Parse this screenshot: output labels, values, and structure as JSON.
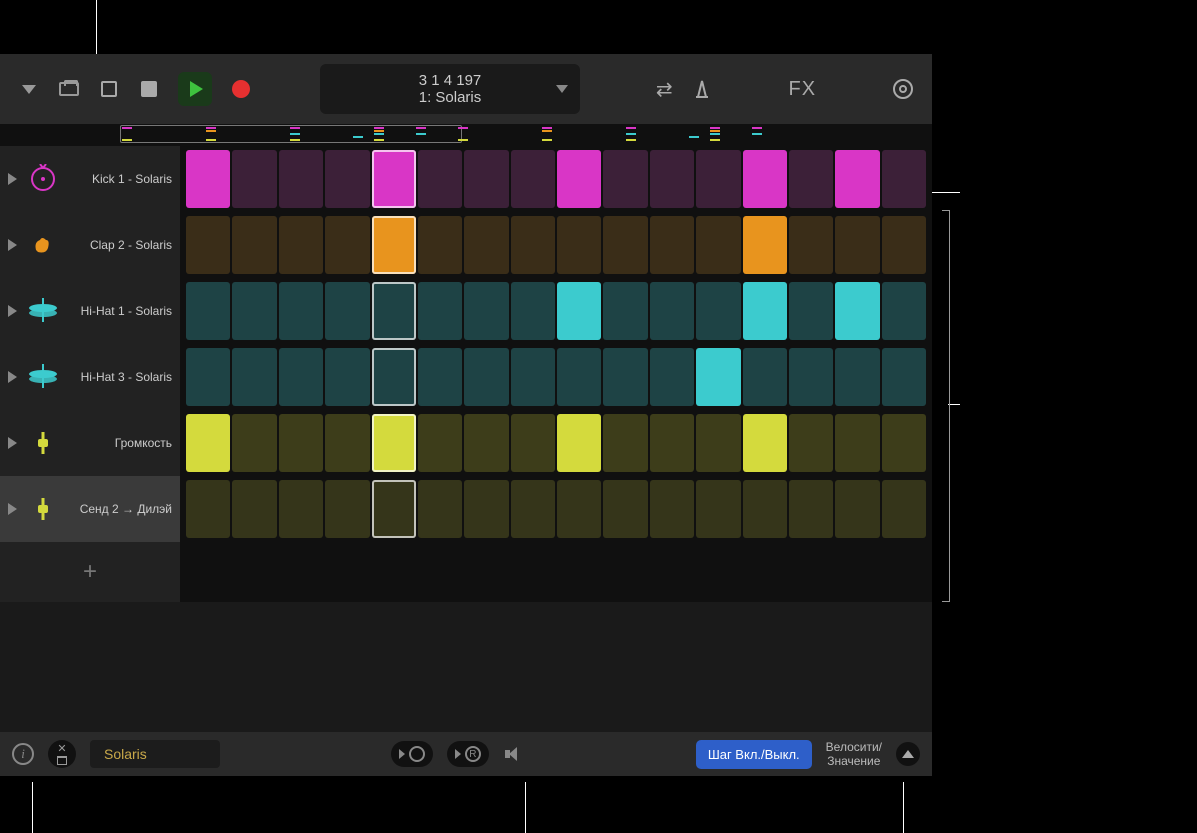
{
  "toolbar": {
    "position": "3  1  4  197",
    "track_display": "1: Solaris",
    "fx_label": "FX"
  },
  "tracks": [
    {
      "name": "Kick 1 - Solaris",
      "icon": "kick",
      "icon_color": "#d936c6",
      "selected": false
    },
    {
      "name": "Clap 2 - Solaris",
      "icon": "clap",
      "icon_color": "#e8941e",
      "selected": false
    },
    {
      "name": "Hi-Hat 1 - Solaris",
      "icon": "hihat",
      "icon_color": "#3ccbce",
      "selected": false
    },
    {
      "name": "Hi-Hat 3 - Solaris",
      "icon": "hihat",
      "icon_color": "#3ccbce",
      "selected": false
    },
    {
      "name": "Громкость",
      "icon": "volume",
      "icon_color": "#d4da3d",
      "selected": false
    },
    {
      "name": "Сенд 2 → Дилэй",
      "icon": "send",
      "icon_color": "#d4da3d",
      "selected": true
    }
  ],
  "grid": {
    "playhead_col": 4,
    "rows": [
      [
        1,
        0,
        0,
        0,
        1,
        0,
        0,
        0,
        1,
        0,
        0,
        0,
        1,
        0,
        1,
        0
      ],
      [
        0,
        0,
        0,
        0,
        1,
        0,
        0,
        0,
        0,
        0,
        0,
        0,
        1,
        0,
        0,
        0
      ],
      [
        0,
        0,
        0,
        0,
        0,
        0,
        0,
        0,
        1,
        0,
        0,
        0,
        1,
        0,
        1,
        0
      ],
      [
        0,
        0,
        0,
        0,
        0,
        0,
        0,
        0,
        0,
        0,
        0,
        1,
        0,
        0,
        0,
        0
      ],
      [
        1,
        0,
        0,
        0,
        1,
        0,
        0,
        0,
        1,
        0,
        0,
        0,
        1,
        0,
        0,
        0
      ],
      [
        0,
        0,
        0,
        0,
        0,
        0,
        0,
        0,
        0,
        0,
        0,
        0,
        0,
        0,
        0,
        0
      ]
    ]
  },
  "bottom": {
    "pattern_name": "Solaris",
    "step_toggle": "Шаг Вкл./Выкл.",
    "velocity_label": "Велосити/\nЗначение"
  }
}
